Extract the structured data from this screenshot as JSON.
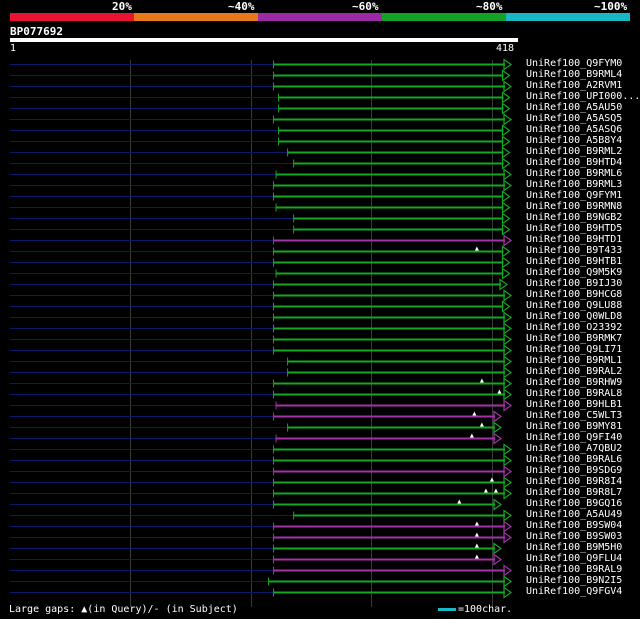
{
  "scale": {
    "labels": [
      "20%",
      "~40%",
      "~60%",
      "~80%",
      "~100%"
    ],
    "colors": [
      "#e8132e",
      "#e8781a",
      "#9b2aa4",
      "#13a128",
      "#18b7c3"
    ]
  },
  "query": {
    "id": "BP077692",
    "start": "1",
    "end": "418"
  },
  "colors": {
    "green": "#14a822",
    "magenta": "#a532a8",
    "gap_line": "#0a1a6a",
    "grid": "#3a3a3a"
  },
  "hits": [
    {
      "label": "UniRef100_Q9FYM0",
      "start": 0.525,
      "end": 0.998,
      "color": "green",
      "markers": []
    },
    {
      "label": "UniRef100_B9RML4",
      "start": 0.525,
      "end": 0.995,
      "color": "green",
      "markers": []
    },
    {
      "label": "UniRef100_A2RVM1",
      "start": 0.525,
      "end": 0.998,
      "color": "green",
      "markers": []
    },
    {
      "label": "UniRef100_UPI000...",
      "start": 0.535,
      "end": 0.995,
      "color": "green",
      "markers": []
    },
    {
      "label": "UniRef100_A5AU50",
      "start": 0.535,
      "end": 0.995,
      "color": "green",
      "markers": []
    },
    {
      "label": "UniRef100_A5ASQ5",
      "start": 0.525,
      "end": 0.998,
      "color": "green",
      "markers": []
    },
    {
      "label": "UniRef100_A5ASQ6",
      "start": 0.535,
      "end": 0.995,
      "color": "green",
      "markers": []
    },
    {
      "label": "UniRef100_A5B8Y4",
      "start": 0.535,
      "end": 0.995,
      "color": "green",
      "markers": []
    },
    {
      "label": "UniRef100_B9RML2",
      "start": 0.553,
      "end": 0.995,
      "color": "green",
      "markers": []
    },
    {
      "label": "UniRef100_B9HTD4",
      "start": 0.565,
      "end": 0.995,
      "color": "green",
      "markers": []
    },
    {
      "label": "UniRef100_B9RML6",
      "start": 0.53,
      "end": 0.998,
      "color": "green",
      "markers": []
    },
    {
      "label": "UniRef100_B9RML3",
      "start": 0.525,
      "end": 0.998,
      "color": "green",
      "markers": []
    },
    {
      "label": "UniRef100_Q9FYM1",
      "start": 0.525,
      "end": 0.995,
      "color": "green",
      "markers": []
    },
    {
      "label": "UniRef100_B9RMN8",
      "start": 0.53,
      "end": 0.995,
      "color": "green",
      "markers": []
    },
    {
      "label": "UniRef100_B9NGB2",
      "start": 0.565,
      "end": 0.995,
      "color": "green",
      "markers": []
    },
    {
      "label": "UniRef100_B9HTD5",
      "start": 0.565,
      "end": 0.995,
      "color": "green",
      "markers": []
    },
    {
      "label": "UniRef100_B9HTD1",
      "start": 0.525,
      "end": 0.998,
      "color": "magenta",
      "markers": []
    },
    {
      "label": "UniRef100_B9T433",
      "start": 0.525,
      "end": 0.995,
      "color": "green",
      "markers": [
        0.93
      ]
    },
    {
      "label": "UniRef100_B9HTB1",
      "start": 0.525,
      "end": 0.995,
      "color": "green",
      "markers": []
    },
    {
      "label": "UniRef100_Q9M5K9",
      "start": 0.53,
      "end": 0.995,
      "color": "green",
      "markers": []
    },
    {
      "label": "UniRef100_B9IJ30",
      "start": 0.525,
      "end": 0.99,
      "color": "green",
      "markers": []
    },
    {
      "label": "UniRef100_B9HCG8",
      "start": 0.525,
      "end": 0.998,
      "color": "green",
      "markers": []
    },
    {
      "label": "UniRef100_Q9LU88",
      "start": 0.525,
      "end": 0.995,
      "color": "green",
      "markers": []
    },
    {
      "label": "UniRef100_Q0WLD8",
      "start": 0.525,
      "end": 0.998,
      "color": "green",
      "markers": []
    },
    {
      "label": "UniRef100_O23392",
      "start": 0.525,
      "end": 0.998,
      "color": "green",
      "markers": []
    },
    {
      "label": "UniRef100_B9RMK7",
      "start": 0.525,
      "end": 0.998,
      "color": "green",
      "markers": []
    },
    {
      "label": "UniRef100_Q9LI71",
      "start": 0.525,
      "end": 0.998,
      "color": "green",
      "markers": []
    },
    {
      "label": "UniRef100_B9RML1",
      "start": 0.553,
      "end": 0.998,
      "color": "green",
      "markers": []
    },
    {
      "label": "UniRef100_B9RAL2",
      "start": 0.553,
      "end": 0.998,
      "color": "green",
      "markers": []
    },
    {
      "label": "UniRef100_B9RHW9",
      "start": 0.525,
      "end": 0.998,
      "color": "green",
      "markers": [
        0.94
      ]
    },
    {
      "label": "UniRef100_B9RAL8",
      "start": 0.525,
      "end": 0.998,
      "color": "green",
      "markers": [
        0.975
      ]
    },
    {
      "label": "UniRef100_B9HLB1",
      "start": 0.53,
      "end": 0.998,
      "color": "magenta",
      "markers": []
    },
    {
      "label": "UniRef100_C5WLT3",
      "start": 0.525,
      "end": 0.978,
      "color": "magenta",
      "markers": [
        0.925
      ]
    },
    {
      "label": "UniRef100_B9MY81",
      "start": 0.553,
      "end": 0.978,
      "color": "green",
      "markers": [
        0.94
      ]
    },
    {
      "label": "UniRef100_Q9FI40",
      "start": 0.53,
      "end": 0.978,
      "color": "magenta",
      "markers": [
        0.92
      ]
    },
    {
      "label": "UniRef100_A7QBU2",
      "start": 0.525,
      "end": 0.998,
      "color": "green",
      "markers": []
    },
    {
      "label": "UniRef100_B9RAL6",
      "start": 0.525,
      "end": 0.998,
      "color": "green",
      "markers": []
    },
    {
      "label": "UniRef100_B9SDG9",
      "start": 0.525,
      "end": 0.998,
      "color": "magenta",
      "markers": []
    },
    {
      "label": "UniRef100_B9R8I4",
      "start": 0.525,
      "end": 0.998,
      "color": "green",
      "markers": [
        0.96
      ]
    },
    {
      "label": "UniRef100_B9R8L7",
      "start": 0.525,
      "end": 0.998,
      "color": "green",
      "markers": [
        0.948,
        0.968
      ]
    },
    {
      "label": "UniRef100_B9GQ16",
      "start": 0.525,
      "end": 0.978,
      "color": "green",
      "markers": [
        0.895
      ]
    },
    {
      "label": "UniRef100_A5AU49",
      "start": 0.565,
      "end": 0.998,
      "color": "green",
      "markers": []
    },
    {
      "label": "UniRef100_B9SW04",
      "start": 0.525,
      "end": 0.998,
      "color": "magenta",
      "markers": [
        0.93
      ]
    },
    {
      "label": "UniRef100_B9SW03",
      "start": 0.525,
      "end": 0.998,
      "color": "magenta",
      "markers": [
        0.93
      ]
    },
    {
      "label": "UniRef100_B9M5H0",
      "start": 0.525,
      "end": 0.978,
      "color": "green",
      "markers": [
        0.93
      ]
    },
    {
      "label": "UniRef100_Q9FLU4",
      "start": 0.525,
      "end": 0.978,
      "color": "magenta",
      "markers": [
        0.93
      ]
    },
    {
      "label": "UniRef100_B9RAL9",
      "start": 0.525,
      "end": 0.998,
      "color": "magenta",
      "markers": []
    },
    {
      "label": "UniRef100_B9N2I5",
      "start": 0.515,
      "end": 0.998,
      "color": "green",
      "markers": []
    },
    {
      "label": "UniRef100_Q9FGV4",
      "start": 0.525,
      "end": 0.998,
      "color": "green",
      "markers": []
    }
  ],
  "legend": {
    "gaps_prefix": "Large gaps:",
    "gaps_query": "(in Query)/",
    "gaps_subject": "- (in Subject)",
    "scale_text": "=100char."
  }
}
